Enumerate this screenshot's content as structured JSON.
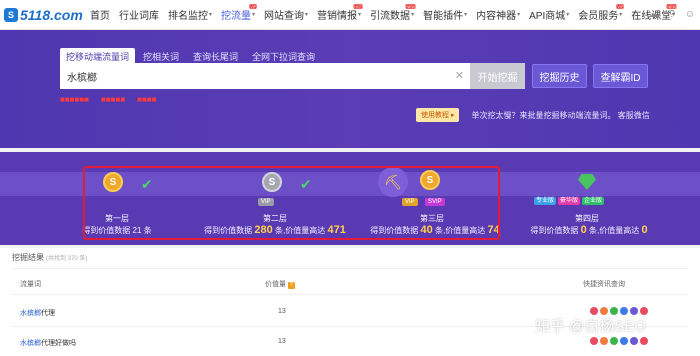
{
  "brand": {
    "logo_text": "5118.com"
  },
  "nav": {
    "items": [
      {
        "label": "首页"
      },
      {
        "label": "行业词库"
      },
      {
        "label": "排名监控",
        "caret": "▾"
      },
      {
        "label": "挖流量",
        "caret": "▾",
        "active": true,
        "badge": "VIP"
      },
      {
        "label": "网站查询",
        "caret": "▾"
      },
      {
        "label": "营销情报",
        "caret": "▾",
        "badge": "HOT"
      },
      {
        "label": "引流数据",
        "caret": "▾",
        "badge": "NEW"
      },
      {
        "label": "智能插件",
        "caret": "▾"
      },
      {
        "label": "内容神器",
        "caret": "▾"
      },
      {
        "label": "API商城",
        "caret": "▾"
      },
      {
        "label": "会员服务",
        "caret": "▾",
        "badge": "VIP"
      },
      {
        "label": "在线课堂",
        "caret": "▾",
        "badge": "NEW"
      }
    ],
    "icons": [
      "search-icon",
      "cloud-icon",
      "question-icon",
      "user-icon"
    ]
  },
  "search": {
    "tabs": [
      "挖移动端流量词",
      "挖相关词",
      "查询长尾词",
      "全网下拉词查询"
    ],
    "value": "水槟榔",
    "start_button": "开始挖掘",
    "history_button": "挖掘历史",
    "id_button": "查解霸ID",
    "options": [
      "■■■■■■",
      "■■■■■",
      "■■■■"
    ],
    "help_button": "使用教程 ▸",
    "tip": "单次挖太慢？来批量挖掘移动端流量词。 客服微信"
  },
  "layers": [
    {
      "name": "第一层",
      "stat_prefix": "得到价值数据",
      "count": "21",
      "stat_mid": "条",
      "max": "",
      "stat_suffix": ""
    },
    {
      "name": "第二层",
      "stat_prefix": "得到价值数据",
      "count": "280",
      "stat_mid": "条,价值量高达",
      "max": "471",
      "stat_suffix": "",
      "tag": "VIP"
    },
    {
      "name": "第三层",
      "stat_prefix": "得到价值数据",
      "count": "40",
      "stat_mid": "条,价值量高达",
      "max": "74",
      "stat_suffix": "",
      "tags": [
        "VIP",
        "SVIP"
      ]
    },
    {
      "name": "第四层",
      "stat_prefix": "得到价值数据",
      "count": "0",
      "stat_mid": "条,价值量高达",
      "max": "0",
      "stat_suffix": "",
      "tags": [
        "专业版",
        "豪华版",
        "企业版"
      ]
    }
  ],
  "results": {
    "title": "挖掘结果",
    "subtitle": "(共找到 370 条)",
    "col_keyword": "流量词",
    "col_value": "价值量",
    "col_quick": "快捷资讯查询",
    "rows": [
      {
        "kw_hl": "水槟榔",
        "kw_rest": "代理",
        "value": "13"
      },
      {
        "kw_hl": "水槟榔",
        "kw_rest": "代理好做吗",
        "value": "13"
      }
    ]
  },
  "watermark": "知乎 @白杨SEO"
}
